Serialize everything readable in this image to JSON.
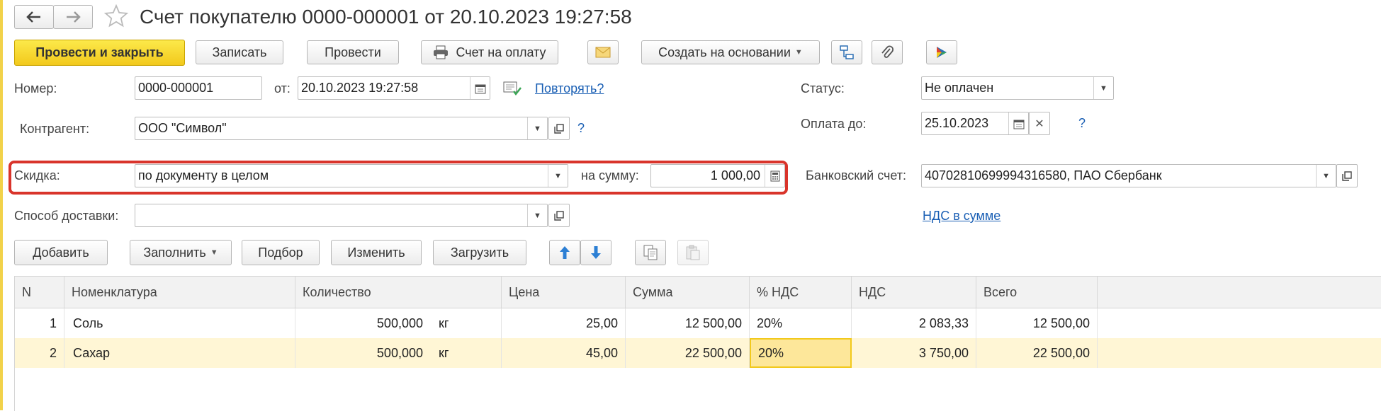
{
  "header": {
    "title": "Счет покупателю 0000-000001 от 20.10.2023 19:27:58"
  },
  "toolbar": {
    "post_close": "Провести и закрыть",
    "save": "Записать",
    "post": "Провести",
    "invoice_print": "Счет на оплату",
    "create_based": "Создать на основании"
  },
  "form": {
    "number_label": "Номер:",
    "number_value": "0000-000001",
    "from_label": "от:",
    "date_value": "20.10.2023 19:27:58",
    "repeat_link": "Повторять?",
    "status_label": "Статус:",
    "status_value": "Не оплачен",
    "counterparty_label": "Контрагент:",
    "counterparty_value": "ООО \"Символ\"",
    "help_mark": "?",
    "pay_until_label": "Оплата до:",
    "pay_until_value": "25.10.2023",
    "discount_label": "Скидка:",
    "discount_value": "по документу в целом",
    "sum_label": "на сумму:",
    "sum_value": "1 000,00",
    "bank_label": "Банковский счет:",
    "bank_value": "40702810699994316580, ПАО Сбербанк",
    "delivery_label": "Способ доставки:",
    "delivery_value": "",
    "vat_link": "НДС в сумме"
  },
  "table_toolbar": {
    "add": "Добавить",
    "fill": "Заполнить",
    "pick": "Подбор",
    "change": "Изменить",
    "load": "Загрузить"
  },
  "table": {
    "columns": [
      "N",
      "Номенклатура",
      "Количество",
      "Цена",
      "Сумма",
      "% НДС",
      "НДС",
      "Всего"
    ],
    "rows": [
      {
        "n": "1",
        "item": "Соль",
        "qty": "500,000",
        "unit": "кг",
        "price": "25,00",
        "sum": "12 500,00",
        "vat_rate": "20%",
        "vat": "2 083,33",
        "total": "12 500,00"
      },
      {
        "n": "2",
        "item": "Сахар",
        "qty": "500,000",
        "unit": "кг",
        "price": "45,00",
        "sum": "22 500,00",
        "vat_rate": "20%",
        "vat": "3 750,00",
        "total": "22 500,00"
      }
    ]
  },
  "colors": {
    "accent_yellow": "#f2c91c",
    "link_blue": "#1a5fb4",
    "highlight_red": "#d9342b",
    "selected_row": "#fff6d5"
  }
}
